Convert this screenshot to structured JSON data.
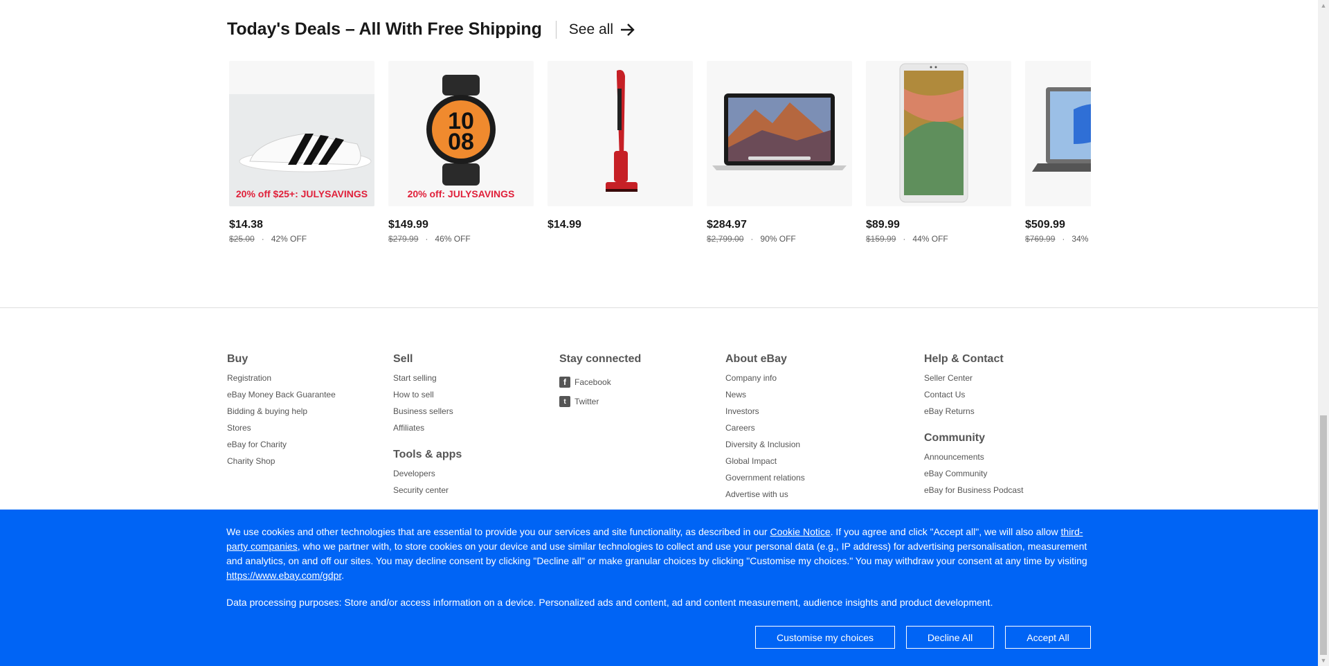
{
  "deals": {
    "title": "Today's Deals – All With Free Shipping",
    "see_all": "See all",
    "items": [
      {
        "price": "$14.38",
        "original": "$25.00",
        "discount": "42% OFF",
        "promo": "20% off $25+: JULYSAVINGS",
        "image": "slide-sandal"
      },
      {
        "price": "$149.99",
        "original": "$279.99",
        "discount": "46% OFF",
        "promo": "20% off: JULYSAVINGS",
        "image": "smartwatch"
      },
      {
        "price": "$14.99",
        "original": "",
        "discount": "",
        "promo": "",
        "image": "stick-vacuum"
      },
      {
        "price": "$284.97",
        "original": "$2,799.00",
        "discount": "90% OFF",
        "promo": "",
        "image": "laptop-macbook"
      },
      {
        "price": "$89.99",
        "original": "$159.99",
        "discount": "44% OFF",
        "promo": "",
        "image": "tablet"
      },
      {
        "price": "$509.99",
        "original": "$769.99",
        "discount": "34%",
        "promo": "",
        "image": "laptop"
      }
    ]
  },
  "footer": {
    "buy": {
      "heading": "Buy",
      "links": [
        "Registration",
        "eBay Money Back Guarantee",
        "Bidding & buying help",
        "Stores",
        "eBay for Charity",
        "Charity Shop"
      ]
    },
    "sell": {
      "heading": "Sell",
      "links": [
        "Start selling",
        "How to sell",
        "Business sellers",
        "Affiliates"
      ]
    },
    "tools": {
      "heading": "Tools & apps",
      "links": [
        "Developers",
        "Security center"
      ]
    },
    "stay": {
      "heading": "Stay connected",
      "links": [
        "Facebook",
        "Twitter"
      ]
    },
    "about": {
      "heading": "About eBay",
      "links": [
        "Company info",
        "News",
        "Investors",
        "Careers",
        "Diversity & Inclusion",
        "Global Impact",
        "Government relations",
        "Advertise with us"
      ]
    },
    "help": {
      "heading": "Help & Contact",
      "links": [
        "Seller Center",
        "Contact Us",
        "eBay Returns"
      ]
    },
    "community": {
      "heading": "Community",
      "links": [
        "Announcements",
        "eBay Community",
        "eBay for Business Podcast"
      ]
    }
  },
  "cookie": {
    "text_1": "We use cookies and other technologies that are essential to provide you our services and site functionality, as described in our ",
    "link_notice": "Cookie Notice",
    "text_2": ". If you agree and click \"Accept all\", we will also allow ",
    "link_third": "third-party companies",
    "text_3": ", who we partner with, to store cookies on your device and use similar technologies to collect and use your personal data (e.g., IP address) for advertising personalisation, measurement and analytics, on and off our sites. You may decline consent by clicking \"Decline all\" or make granular choices by clicking \"Customise my choices.\" You may withdraw your consent at any time by visiting ",
    "link_gdpr": "https://www.ebay.com/gdpr",
    "text_4": ".",
    "purposes": "Data processing purposes: Store and/or access information on a device. Personalized ads and content, ad and content measurement, audience insights and product development.",
    "customise": "Customise my choices",
    "decline": "Decline All",
    "accept": "Accept All"
  },
  "colors": {
    "banner": "#0064f5",
    "promo_red": "#e0203a"
  }
}
